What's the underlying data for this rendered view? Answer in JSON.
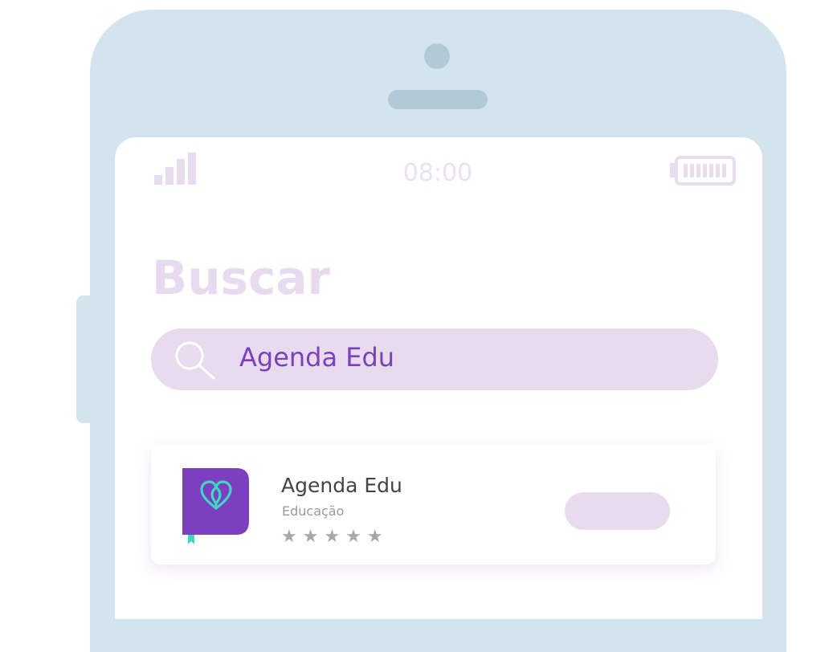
{
  "status_bar": {
    "time": "08:00",
    "signal_icon": "signal-bars-icon",
    "battery_icon": "battery-full-icon"
  },
  "page": {
    "title": "Buscar"
  },
  "search": {
    "value": "Agenda Edu",
    "icon": "search-icon"
  },
  "result": {
    "app_name": "Agenda Edu",
    "category": "Educação",
    "rating_stars": "★★★★★",
    "rating": 5,
    "icon": "app-logo-icon",
    "get_button_label": ""
  },
  "colors": {
    "phone_frame": "#d3e4ef",
    "accent_purple": "#7b3fc0",
    "logo_teal": "#3fd6c4",
    "search_bg": "#e8dbee"
  }
}
